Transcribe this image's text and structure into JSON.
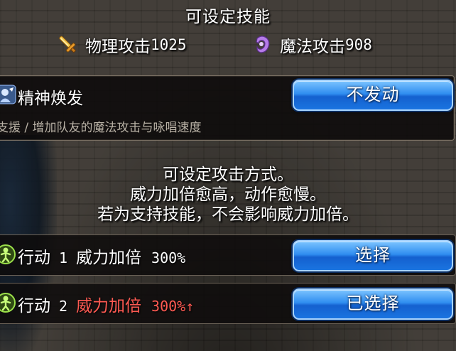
{
  "header": {
    "title": "可设定技能"
  },
  "stats": {
    "physical_label": "物理攻击",
    "physical_value": "1025",
    "magic_label": "魔法攻击",
    "magic_value": "908",
    "physical_icon": "sword-icon",
    "magic_icon": "magic-hand-icon"
  },
  "skill": {
    "name": "精神焕发",
    "description": "支援 / 增加队友的魔法攻击与咏唱速度",
    "button_label": "不发动",
    "icon": "spirit-skill-icon"
  },
  "explanation": {
    "line1": "可设定攻击方式。",
    "line2": "威力加倍愈高，动作愈慢。",
    "line3": "若为支持技能，不会影响威力加倍。"
  },
  "actions": [
    {
      "label": "行动",
      "index": "1",
      "power_label": "威力加倍",
      "power_value": "300%",
      "highlight": false,
      "button_label": "选择"
    },
    {
      "label": "行动",
      "index": "2",
      "power_label": "威力加倍",
      "power_value": "300%↑",
      "highlight": true,
      "button_label": "已选择"
    }
  ],
  "colors": {
    "button_blue": "#1a74e0",
    "highlight_red": "#ff5a52",
    "text_white": "#ffffff",
    "desc_gray": "#b9b2a6"
  }
}
